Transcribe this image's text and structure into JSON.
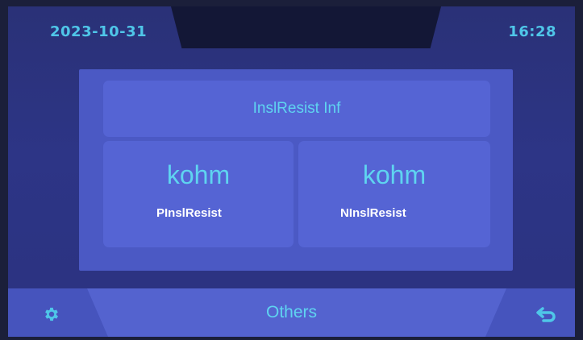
{
  "status_bar": {
    "date": "2023-10-31",
    "time": "16:28"
  },
  "panel": {
    "title": "InslResist Inf",
    "cells": [
      {
        "value": "kohm",
        "label": "PInslResist"
      },
      {
        "value": "kohm",
        "label": "NInslResist"
      }
    ]
  },
  "bottom_bar": {
    "label": "Others",
    "left_icon": "gear-icon",
    "right_icon": "back-arrow-icon"
  },
  "colors": {
    "accent_text": "#5fd4f0",
    "panel": "#4b59c4",
    "cell": "#5564d4",
    "background": "#2d3586"
  }
}
